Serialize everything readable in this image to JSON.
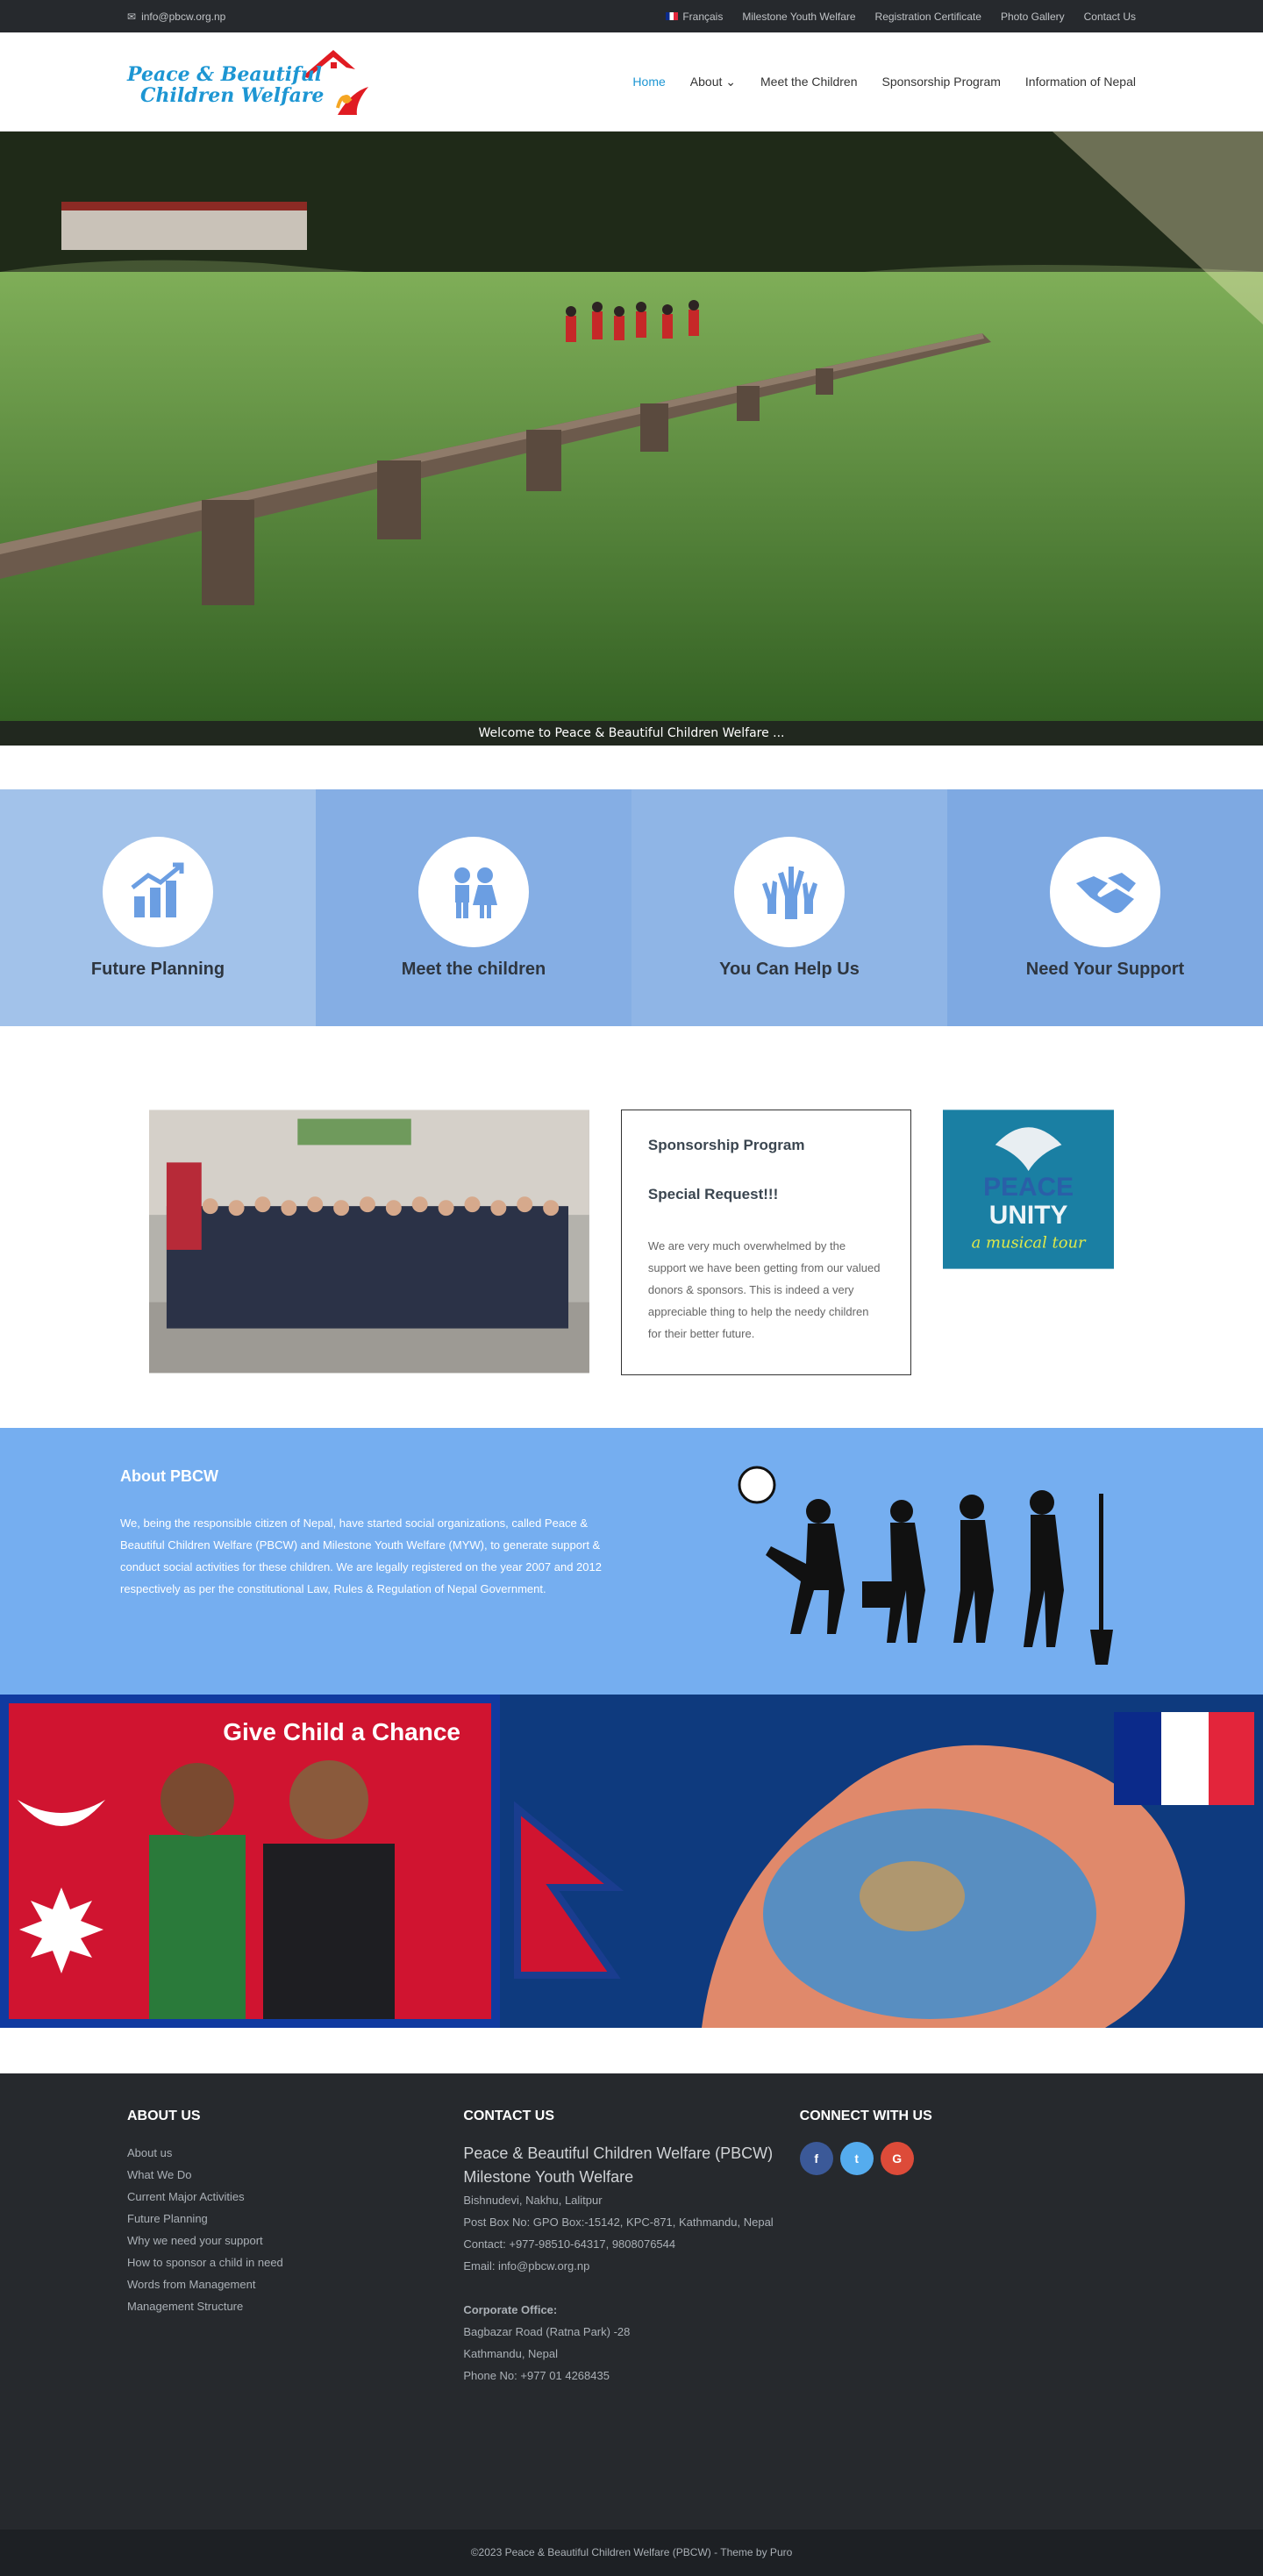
{
  "topbar": {
    "email": "info@pbcw.org.np",
    "links": [
      "Français",
      "Milestone Youth Welfare",
      "Registration Certificate",
      "Photo Gallery",
      "Contact Us"
    ]
  },
  "logo": {
    "line1": "Peace & Beautiful",
    "line2": "Children Welfare"
  },
  "nav": [
    "Home",
    "About",
    "Meet the Children",
    "Sponsorship Program",
    "Information of Nepal"
  ],
  "nav_chevron": "⌄",
  "hero": {
    "caption": "Welcome to Peace & Beautiful Children Welfare ..."
  },
  "features": [
    {
      "title": "Future Planning",
      "icon": "chart-icon"
    },
    {
      "title": "Meet the children",
      "icon": "children-icon"
    },
    {
      "title": "You Can Help Us",
      "icon": "hands-icon"
    },
    {
      "title": "Need Your Support",
      "icon": "handshake-icon"
    }
  ],
  "sponsor": {
    "title": "Sponsorship Program",
    "subtitle": "Special Request!!!",
    "body": "We are very much overwhelmed by the support we have been getting from our valued donors & sponsors. This is indeed a very appreciable thing to help the needy children for their better future."
  },
  "peace": {
    "line1": "PEACE",
    "line2": "UNITY",
    "line3": "a musical tour"
  },
  "about": {
    "title": "About PBCW",
    "body": "We, being the responsible citizen of Nepal, have started social organizations, called Peace & Beautiful Children Welfare (PBCW) and Milestone Youth Welfare (MYW), to generate support & conduct social activities for these children. We are legally registered on the year 2007 and 2012 respectively as per the constitutional Law, Rules & Regulation of Nepal Government."
  },
  "banner": {
    "text": "Give Child a Chance"
  },
  "footer": {
    "about_title": "ABOUT US",
    "about_links": [
      "About us",
      "What We Do",
      "Current Major Activities",
      "Future Planning",
      "Why we need your support",
      "How to sponsor a child in need",
      "Words from Management",
      "Management Structure"
    ],
    "contact_title": "CONTACT US",
    "org1": "Peace & Beautiful Children Welfare (PBCW)",
    "org2": "Milestone Youth Welfare",
    "address": "Bishnudevi, Nakhu, Lalitpur",
    "pobox": "Post Box No: GPO Box:-15142, KPC-871, Kathmandu, Nepal",
    "contact": "Contact: +977-98510-64317, 9808076544",
    "email": "Email: info@pbcw.org.np",
    "corp_title": "Corporate Office:",
    "corp1": "Bagbazar Road (Ratna Park) -28",
    "corp2": "Kathmandu, Nepal",
    "corp3": "Phone No: +977 01 4268435",
    "connect_title": "CONNECT WITH US",
    "social": [
      {
        "label": "f",
        "color": "#3b5998"
      },
      {
        "label": "t",
        "color": "#55acee"
      },
      {
        "label": "G",
        "color": "#dd4b39"
      }
    ],
    "copyright": "©2023 Peace & Beautiful Children Welfare (PBCW)  -  Theme by Puro"
  }
}
